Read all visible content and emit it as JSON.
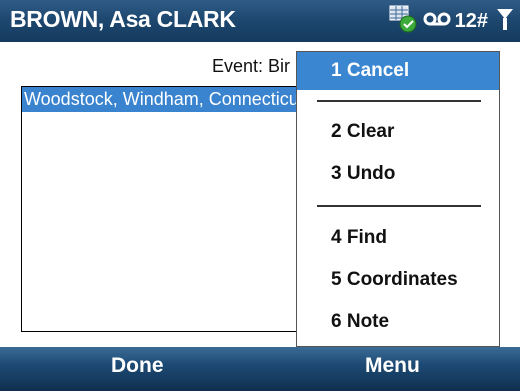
{
  "header": {
    "title": "BROWN, Asa CLARK",
    "status_text": "12#"
  },
  "event_label": "Event: Bir",
  "place_text": "Woodstock, Windham, Connecticut",
  "menu": {
    "items": [
      {
        "label": "1 Cancel"
      },
      {
        "label": "2 Clear"
      },
      {
        "label": "3 Undo"
      },
      {
        "label": "4 Find"
      },
      {
        "label": "5 Coordinates"
      },
      {
        "label": "6 Note"
      }
    ]
  },
  "softkeys": {
    "left": "Done",
    "right": "Menu"
  },
  "colors": {
    "title_bar": "#1e4870",
    "selection": "#3b86d1",
    "softkey_bar": "#1d4a74"
  },
  "icons": {
    "status": [
      "sync-icon",
      "voicemail-icon",
      "signal-icon"
    ]
  }
}
